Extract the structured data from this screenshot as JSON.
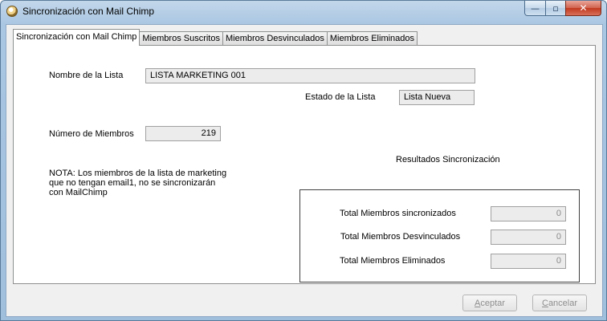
{
  "window": {
    "title": "Sincronización con Mail Chimp",
    "controls": {
      "minimize": "—",
      "maximize": "▫",
      "close": "✕"
    }
  },
  "tabs": [
    {
      "label": "Sincronización con Mail Chimp",
      "active": true
    },
    {
      "label": "Miembros Suscritos",
      "active": false
    },
    {
      "label": "Miembros Desvinculados",
      "active": false
    },
    {
      "label": "Miembros Eliminados",
      "active": false
    }
  ],
  "form": {
    "list_name_label": "Nombre de la Lista",
    "list_name_value": "LISTA MARKETING 001",
    "list_state_label": "Estado de la Lista",
    "list_state_value": "Lista Nueva",
    "member_count_label": "Número de Miembros",
    "member_count_value": "219",
    "note_line1": "NOTA: Los miembros de la lista de marketing",
    "note_line2": "que no tengan email1, no se sincronizarán",
    "note_line3": "con MailChimp"
  },
  "results": {
    "title": "Resultados Sincronización",
    "synced_label": "Total Miembros sincronizados",
    "synced_value": "0",
    "unlinked_label": "Total Miembros Desvinculados",
    "unlinked_value": "0",
    "deleted_label": "Total Miembros Eliminados",
    "deleted_value": "0"
  },
  "buttons": {
    "accept_mnemonic": "A",
    "accept_rest": "ceptar",
    "cancel_mnemonic": "C",
    "cancel_rest": "ancelar"
  }
}
